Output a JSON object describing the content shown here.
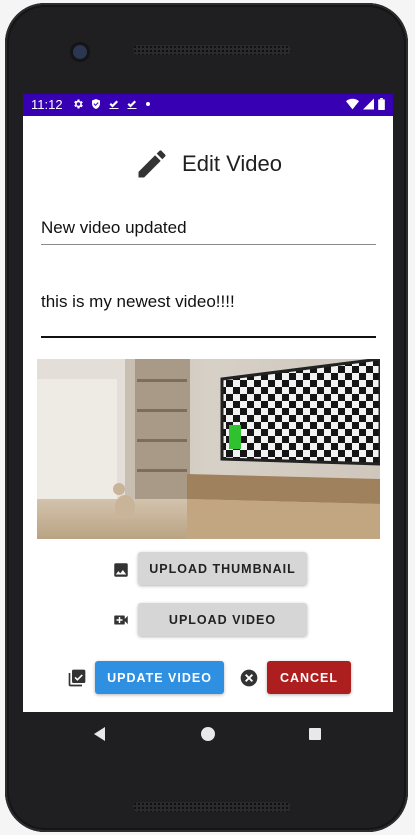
{
  "status_bar": {
    "time": "11:12",
    "left_icons": [
      "settings-icon",
      "shield-icon",
      "check-done-icon",
      "check-done-icon",
      "dot-icon"
    ],
    "right_icons": [
      "wifi-icon",
      "signal-icon",
      "battery-icon"
    ],
    "background": "#3700b3"
  },
  "header": {
    "title": "Edit Video",
    "icon": "pencil-icon"
  },
  "form": {
    "title_value": "New video updated",
    "description_value": "this is my newest video!!!!"
  },
  "thumbnail": {
    "icon": "image-icon"
  },
  "buttons": {
    "upload_thumbnail": "UPLOAD THUMBNAIL",
    "upload_video": "UPLOAD VIDEO",
    "update_video": "UPDATE VIDEO",
    "cancel": "CANCEL"
  },
  "colors": {
    "primary": "#2f8fe0",
    "danger": "#ad1f1f",
    "neutral_button": "#d6d6d6"
  },
  "nav_bar": {
    "icons": [
      "back-icon",
      "home-icon",
      "recents-icon"
    ]
  }
}
